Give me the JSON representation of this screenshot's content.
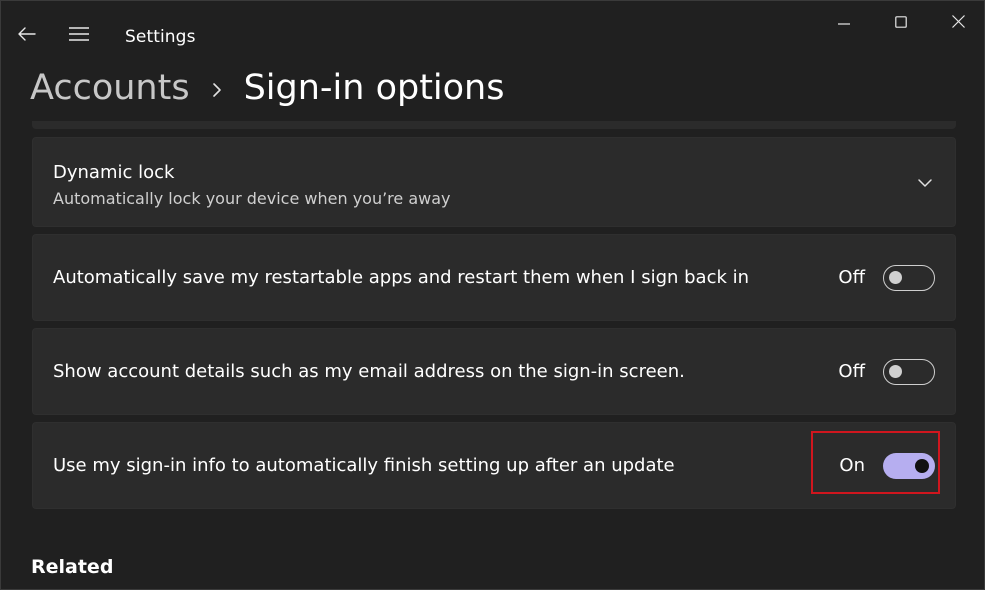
{
  "titlebar": {
    "app_title": "Settings",
    "icons": {
      "back": "back-arrow-icon",
      "menu": "hamburger-menu-icon"
    }
  },
  "window_controls": {
    "minimize": "minimize-icon",
    "maximize": "maximize-icon",
    "close": "close-icon"
  },
  "breadcrumb": {
    "parent": "Accounts",
    "current": "Sign-in options"
  },
  "settings": {
    "dynamic_lock": {
      "title": "Dynamic lock",
      "subtitle": "Automatically lock your device when you’re away"
    },
    "restartable_apps": {
      "label": "Automatically save my restartable apps and restart them when I sign back in",
      "state": "Off",
      "enabled": false
    },
    "account_details": {
      "label": "Show account details such as my email address on the sign-in screen.",
      "state": "Off",
      "enabled": false
    },
    "signin_info": {
      "label": "Use my sign-in info to automatically finish setting up after an update",
      "state": "On",
      "enabled": true
    }
  },
  "related": {
    "heading": "Related"
  },
  "colors": {
    "background": "#202020",
    "card": "#2b2b2b",
    "toggle_on": "#b6aef0",
    "highlight": "#d0161e"
  }
}
